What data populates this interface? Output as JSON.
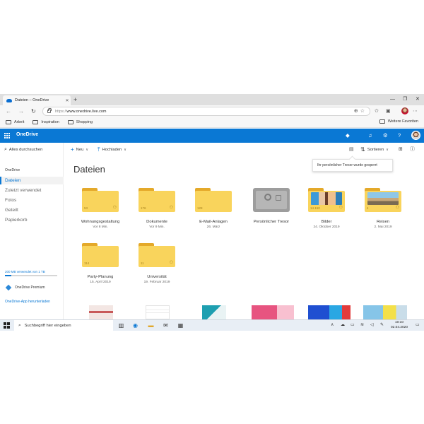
{
  "browser": {
    "tab_title": "Dateien – OneDrive",
    "tab_close": "✕",
    "new_tab": "+",
    "window_controls": [
      "—",
      "❐",
      "✕"
    ],
    "url_prefix": "https://",
    "url_host": "www.onedrive.live.com",
    "favorites": [
      "Arbeit",
      "Inspiration",
      "Shopping"
    ],
    "other_favorites": "Weitere Favoriten"
  },
  "header": {
    "brand": "OneDrive",
    "accent": "#0a78d4"
  },
  "leftnav": {
    "search_label": "Alles durchsuchen",
    "section_label": "OneDrive",
    "items": [
      {
        "label": "Dateien",
        "active": true
      },
      {
        "label": "Zuletzt verwendet",
        "active": false
      },
      {
        "label": "Fotos",
        "active": false
      },
      {
        "label": "Geteilt",
        "active": false
      },
      {
        "label": "Papierkorb",
        "active": false
      }
    ],
    "storage_text": "200 MB verwendet von 1 TB",
    "storage_fraction": 0.12,
    "premium_label": "OneDrive Premium",
    "app_link": "OneDrive-App herunterladen"
  },
  "commandbar": {
    "new_label": "Neu",
    "upload_label": "Hochladen",
    "sort_label": "Sortieren"
  },
  "tooltip": "Ihr persönlicher Tresor wurde gesperrt",
  "page_title": "Dateien",
  "tiles": [
    {
      "name": "Wohnungsgestaltung",
      "date": "Vor 8 Min.",
      "count": "53",
      "kind": "folder",
      "shared": true
    },
    {
      "name": "Dokumente",
      "date": "Vor 9 Min.",
      "count": "176",
      "kind": "folder",
      "shared": true
    },
    {
      "name": "E-Mail-Anlagen",
      "date": "26. März",
      "count": "128",
      "kind": "folder",
      "shared": false
    },
    {
      "name": "Persönlicher Tresor",
      "date": "",
      "count": "",
      "kind": "vault",
      "shared": false
    },
    {
      "name": "Bilder",
      "date": "24. Oktober 2019",
      "count": "14.150",
      "kind": "photo-folder",
      "shared": true
    },
    {
      "name": "Reisen",
      "date": "2. Mai 2019",
      "count": "4",
      "kind": "photo-folder",
      "shared": true
    },
    {
      "name": "Party-Planung",
      "date": "15. April 2019",
      "count": "114",
      "kind": "folder",
      "shared": false
    },
    {
      "name": "Universität",
      "date": "19. Februar 2019",
      "count": "11",
      "kind": "folder",
      "shared": true
    }
  ],
  "taskbar": {
    "search_label": "Suchbegriff hier eingeben",
    "time": "10:10",
    "date": "02.04.2020"
  }
}
